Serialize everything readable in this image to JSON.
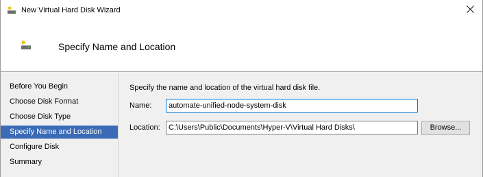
{
  "window": {
    "title": "New Virtual Hard Disk Wizard"
  },
  "header": {
    "title": "Specify Name and Location"
  },
  "nav": {
    "items": [
      {
        "label": "Before You Begin",
        "selected": false
      },
      {
        "label": "Choose Disk Format",
        "selected": false
      },
      {
        "label": "Choose Disk Type",
        "selected": false
      },
      {
        "label": "Specify Name and Location",
        "selected": true
      },
      {
        "label": "Configure Disk",
        "selected": false
      },
      {
        "label": "Summary",
        "selected": false
      }
    ]
  },
  "content": {
    "instruction": "Specify the name and location of the virtual hard disk file.",
    "name_label": "Name:",
    "name_value": "automate-unified-node-system-disk",
    "location_label": "Location:",
    "location_value": "C:\\Users\\Public\\Documents\\Hyper-V\\Virtual Hard Disks\\",
    "browse_label": "Browse..."
  },
  "colors": {
    "selection": "#3b6ab7",
    "focus_border": "#0078d7"
  },
  "icons": {
    "title": "virtual-disk-icon",
    "header": "virtual-disk-icon",
    "close": "close-icon"
  }
}
